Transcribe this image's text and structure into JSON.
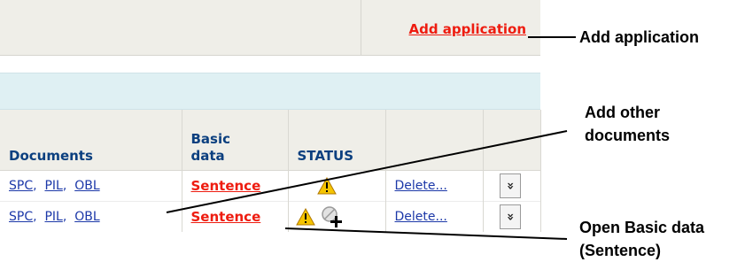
{
  "toolbar": {
    "add_application_link": "Add application"
  },
  "table": {
    "headers": [
      "Documents",
      "Basic\ndata",
      "STATUS",
      "",
      ""
    ],
    "rows": [
      {
        "spc": "SPC",
        "pil": "PIL",
        "obl": "OBL",
        "basic": "Sentence",
        "delete": "Delete...",
        "status_icons": [
          "warning-icon"
        ]
      },
      {
        "spc": "SPC",
        "pil": "PIL",
        "obl": "OBL",
        "basic": "Sentence",
        "delete": "Delete...",
        "status_icons": [
          "warning-icon",
          "cursor-busy-icon"
        ]
      }
    ],
    "separator": ",",
    "expand_glyph": "»"
  },
  "annotations": {
    "add_application": "Add application",
    "add_other_documents": "Add other\ndocuments",
    "open_basic_data": "Open Basic data\n(Sentence)"
  },
  "colors": {
    "link_red": "#ee1c10",
    "link_blue": "#1c38a8",
    "header_text": "#0b3f7f",
    "panel_bg": "#efeee8",
    "band_bg": "#dff0f3"
  }
}
